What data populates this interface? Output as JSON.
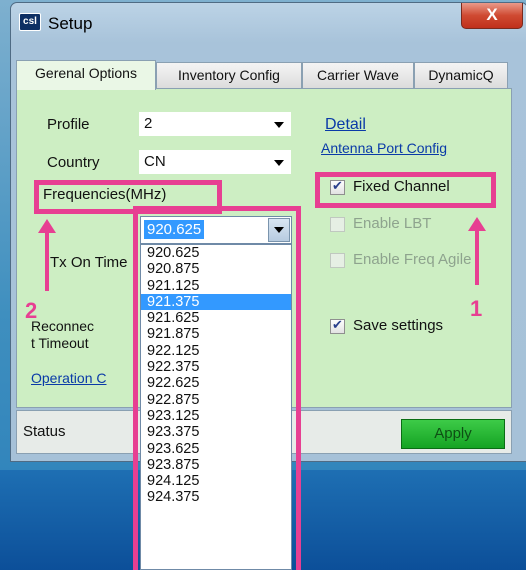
{
  "window": {
    "title": "Setup",
    "app_icon_text": "csl",
    "close_symbol": "X"
  },
  "tabs": [
    {
      "label": "Gerenal Options",
      "active": true
    },
    {
      "label": "Inventory Config",
      "active": false
    },
    {
      "label": "Carrier Wave",
      "active": false
    },
    {
      "label": "DynamicQ",
      "active": false
    }
  ],
  "form": {
    "profile_label": "Profile",
    "profile_value": "2",
    "country_label": "Country",
    "country_value": "CN",
    "frequencies_label": "Frequencies(MHz)",
    "tx_on_time_label": "Tx On Time",
    "reconnect_label_line1": "Reconnec",
    "reconnect_label_line2": "t Timeout",
    "operation_link": "Operation C",
    "detail_link": "Detail",
    "antenna_link": "Antenna Port Config"
  },
  "checkboxes": {
    "fixed_channel": {
      "label": "Fixed Channel",
      "checked": true,
      "enabled": true
    },
    "enable_lbt": {
      "label": "Enable LBT",
      "checked": false,
      "enabled": false
    },
    "enable_freq_agile": {
      "label": "Enable Freq Agile",
      "checked": false,
      "enabled": false
    },
    "save_settings": {
      "label": "Save settings",
      "checked": true,
      "enabled": true
    }
  },
  "frequency_dropdown": {
    "selected": "920.625",
    "highlighted": "921.375",
    "options": [
      "920.625",
      "920.875",
      "921.125",
      "921.375",
      "921.625",
      "921.875",
      "922.125",
      "922.375",
      "922.625",
      "922.875",
      "923.125",
      "923.375",
      "923.625",
      "923.875",
      "924.125",
      "924.375"
    ]
  },
  "status_bar": {
    "status_label": "Status",
    "apply_label": "Apply"
  },
  "annotations": {
    "marker_1": "1",
    "marker_2": "2",
    "color": "#e73f92"
  }
}
